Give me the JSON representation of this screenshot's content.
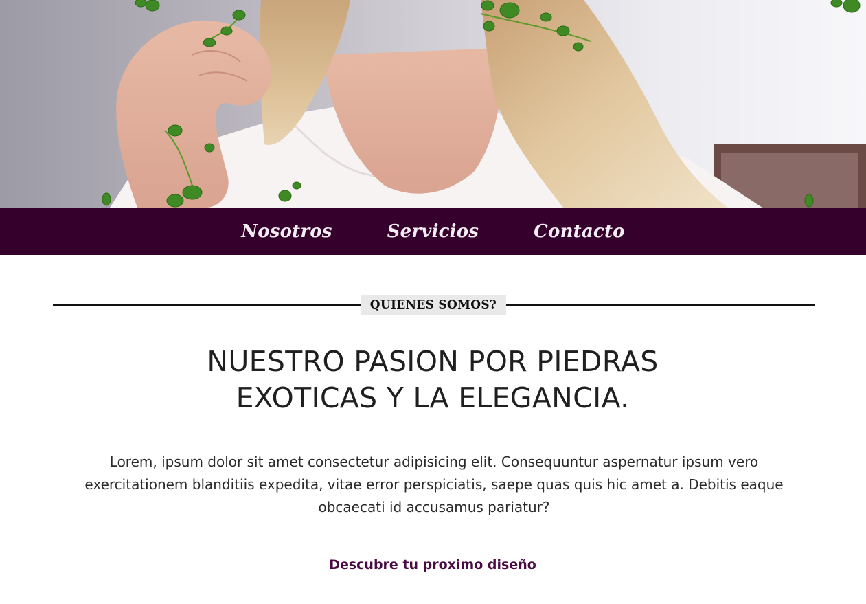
{
  "hero": {
    "image_alt": "Woman with blonde hair in white blouse framed by green ivy leaves"
  },
  "nav": {
    "items": [
      {
        "label": "Nosotros"
      },
      {
        "label": "Servicios"
      },
      {
        "label": "Contacto"
      }
    ]
  },
  "about": {
    "section_label": "QUIENES SOMOS?",
    "headline_line1": "NUESTRO PASION POR PIEDRAS",
    "headline_line2": "EXOTICAS Y LA ELEGANCIA.",
    "body": "Lorem, ipsum dolor sit amet consectetur adipisicing elit. Consequuntur aspernatur ipsum vero exercitationem blanditiis expedita, vitae error perspiciatis, saepe quas quis hic amet a. Debitis eaque obcaecati id accusamus pariatur?",
    "cta_label": "Descubre tu proximo diseño"
  },
  "colors": {
    "nav_background": "#35002c",
    "cta_text": "#4a0a44"
  }
}
